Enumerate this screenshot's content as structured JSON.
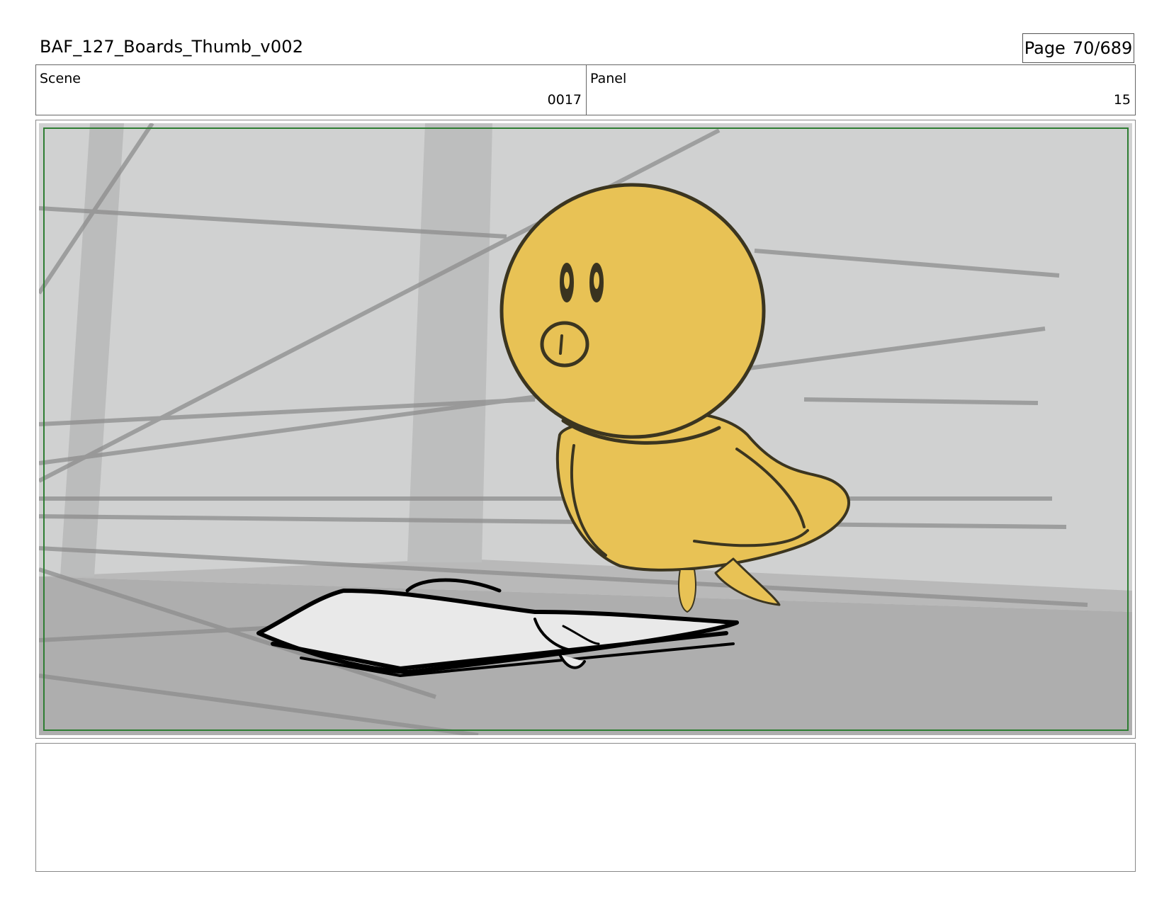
{
  "header": {
    "document_title": "BAF_127_Boards_Thumb_v002",
    "page_label": "Page",
    "page_number": "70/689"
  },
  "info": {
    "scene_label": "Scene",
    "scene_value": "0017",
    "panel_label": "Panel",
    "panel_value": "15"
  },
  "colors": {
    "safe_frame_border": "#2e7d32",
    "bird_fill": "#e8c255",
    "background_wall": "#cfd0d0",
    "floor": "#adadad"
  },
  "notes": {
    "text": ""
  }
}
